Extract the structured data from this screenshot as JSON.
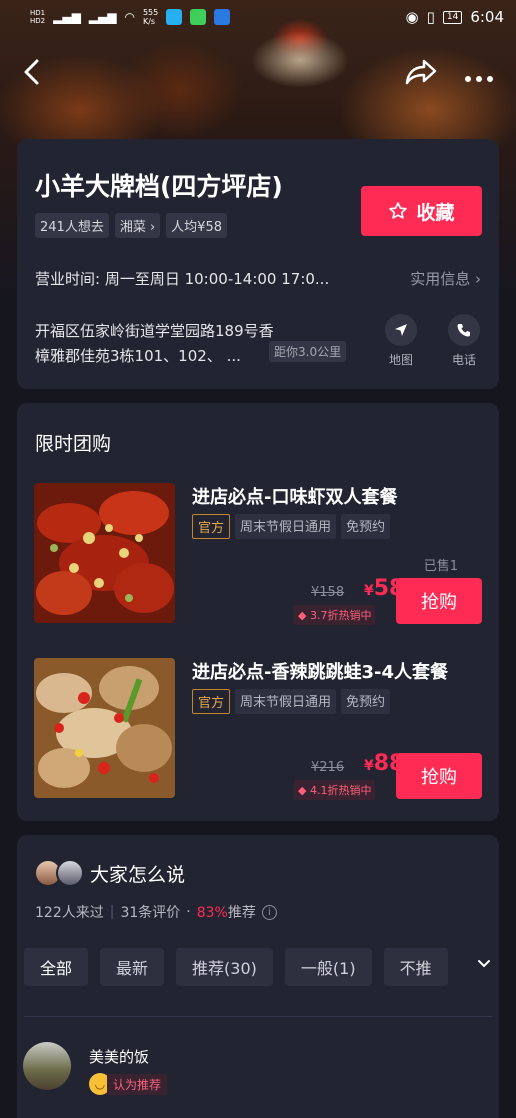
{
  "status_bar": {
    "left_tags": [
      "HD1",
      "HD2"
    ],
    "net_speed": "555",
    "net_unit": "K/s",
    "battery": "14",
    "time": "6:04"
  },
  "store": {
    "name": "小羊大牌档(四方坪店)",
    "tags": [
      "241人想去",
      "湘菜 ›",
      "人均¥58"
    ],
    "favorite_label": "收藏",
    "hours": "营业时间: 周一至周日 10:00-14:00 17:0...",
    "practical_info": "实用信息 ›",
    "address_line1": "开福区伍家岭街道学堂园路189号香",
    "address_line2": "樟雅郡佳苑3栋101、102、 ...",
    "distance": "距你3.0公里",
    "map_label": "地图",
    "phone_label": "电话"
  },
  "deals": {
    "section_title": "限时团购",
    "items": [
      {
        "name": "进店必点-口味虾双人套餐",
        "official_tag": "官方",
        "tags": [
          "周末节假日通用",
          "免预约"
        ],
        "sold": "已售1",
        "original_price": "¥158",
        "price_symbol": "¥",
        "price": "58",
        "discount": "3.7折热销中",
        "buy_label": "抢购"
      },
      {
        "name": "进店必点-香辣跳跳蛙3-4人套餐",
        "official_tag": "官方",
        "tags": [
          "周末节假日通用",
          "免预约"
        ],
        "sold": "",
        "original_price": "¥216",
        "price_symbol": "¥",
        "price": "88",
        "discount": "4.1折热销中",
        "buy_label": "抢购"
      }
    ]
  },
  "reviews": {
    "title": "大家怎么说",
    "visited": "122人来过",
    "count": "31条评价",
    "dot": "·",
    "recommend_pct": "83%",
    "recommend_suffix": "推荐",
    "filters": [
      "全部",
      "最新",
      "推荐(30)",
      "一般(1)",
      "不推"
    ],
    "first_user": {
      "name": "美美的饭",
      "badge": "认为推荐"
    }
  },
  "colors": {
    "accent": "#fe2c55",
    "card_bg": "#222431",
    "page_bg": "#16161f",
    "official": "#e5a64a"
  }
}
